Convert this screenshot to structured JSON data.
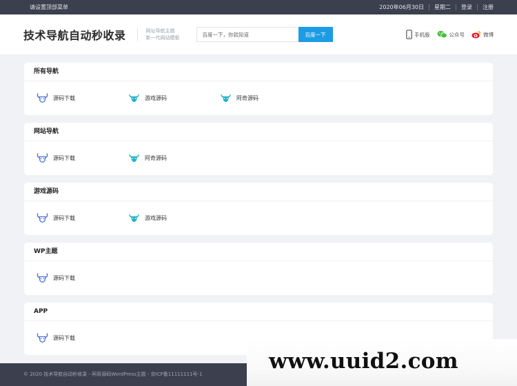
{
  "topbar": {
    "menu_hint": "请设置顶部菜单",
    "date": "2020年06月30日",
    "weekday": "星期二",
    "login": "登录",
    "register": "注册"
  },
  "header": {
    "title": "技术导航自动秒收录",
    "slogan_line1": "网址导航主题",
    "slogan_line2": "新一代网站模板",
    "search_placeholder": "百度一下，你就知道",
    "search_button": "百度一下",
    "links": {
      "mobile": "手机版",
      "wechat": "公众号",
      "weibo": "微博"
    }
  },
  "colors": {
    "icon_outline": "#4a6fd6",
    "icon_filled": "#22b3c9",
    "accent": "#1d9ce5"
  },
  "sections": [
    {
      "title": "所有导航",
      "items": [
        {
          "label": "源码下载",
          "icon": "bull-outline-icon"
        },
        {
          "label": "游戏源码",
          "icon": "bull-filled-icon"
        },
        {
          "label": "阿奇源码",
          "icon": "bull-filled-icon"
        }
      ]
    },
    {
      "title": "网站导航",
      "items": [
        {
          "label": "源码下载",
          "icon": "bull-outline-icon"
        },
        {
          "label": "阿奇源码",
          "icon": "bull-filled-icon"
        }
      ]
    },
    {
      "title": "游戏源码",
      "items": [
        {
          "label": "源码下载",
          "icon": "bull-outline-icon"
        },
        {
          "label": "游戏源码",
          "icon": "bull-filled-icon"
        }
      ]
    },
    {
      "title": "WP主题",
      "items": [
        {
          "label": "源码下载",
          "icon": "bull-outline-icon"
        }
      ]
    },
    {
      "title": "APP",
      "items": [
        {
          "label": "源码下载",
          "icon": "bull-outline-icon"
        }
      ]
    }
  ],
  "footer": {
    "text": "© 2020 技术导航自动秒收录 - 阿奇源码WordPress主题 - 京ICP备11111111号-1"
  },
  "watermark": {
    "text": "www.uuid2.com"
  }
}
